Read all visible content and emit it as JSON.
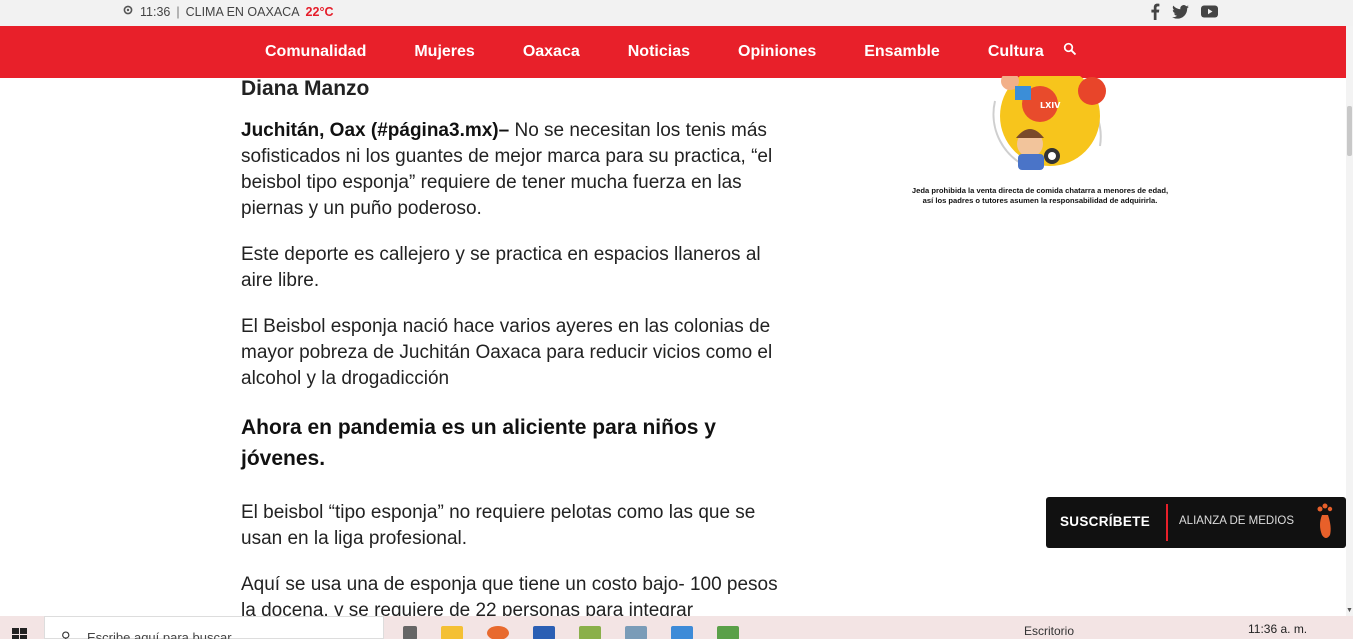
{
  "topbar": {
    "time": "11:36",
    "separator": "|",
    "weather_label": "CLIMA EN OAXACA",
    "temperature": "22°C",
    "social_icons": [
      "facebook-icon",
      "twitter-icon",
      "youtube-icon"
    ]
  },
  "nav": {
    "items": [
      "Comunalidad",
      "Mujeres",
      "Oaxaca",
      "Noticias",
      "Opiniones",
      "Ensamble",
      "Cultura"
    ]
  },
  "article": {
    "author": "Diana Manzo",
    "lead": "Juchitán, Oax (#página3.mx)–",
    "p1": " No se necesitan los tenis más sofisticados ni los guantes de mejor marca para su practica, “el beisbol tipo esponja”  requiere de tener  mucha fuerza en las piernas y un puño poderoso.",
    "p2": "Este deporte es callejero y se practica en espacios llaneros al aire libre.",
    "p3": "El Beisbol esponja nació hace varios ayeres en las colonias de mayor pobreza de Juchitán Oaxaca  para reducir vicios como el alcohol y la drogadicción",
    "heading": "Ahora en pandemia es un aliciente para niños y jóvenes.",
    "p4": "El beisbol “tipo esponja” no requiere pelotas como las que se usan en la liga profesional.",
    "p5": "Aquí se usa una de esponja que tiene un costo bajo- 100 pesos la docena, y se requiere de 22 personas para integrar"
  },
  "ad": {
    "badge": "LXIV",
    "caption_line1": "Jeda prohibida la venta  directa de comida chatarra a menores de edad,",
    "caption_line2": "así los padres o tutores asumen la responsabilidad de adquirirla."
  },
  "subscribe": {
    "label": "SUSCRÍBETE",
    "alliance": "ALIANZA DE MEDIOS"
  },
  "taskbar": {
    "search_placeholder": "Escribe aquí para buscar",
    "desktop_label": "Escritorio",
    "clock": "11:36 a. m."
  },
  "colors": {
    "brand_red": "#e8202a",
    "topbar_bg": "#f2f2f2",
    "subscribe_bg": "#111111"
  }
}
